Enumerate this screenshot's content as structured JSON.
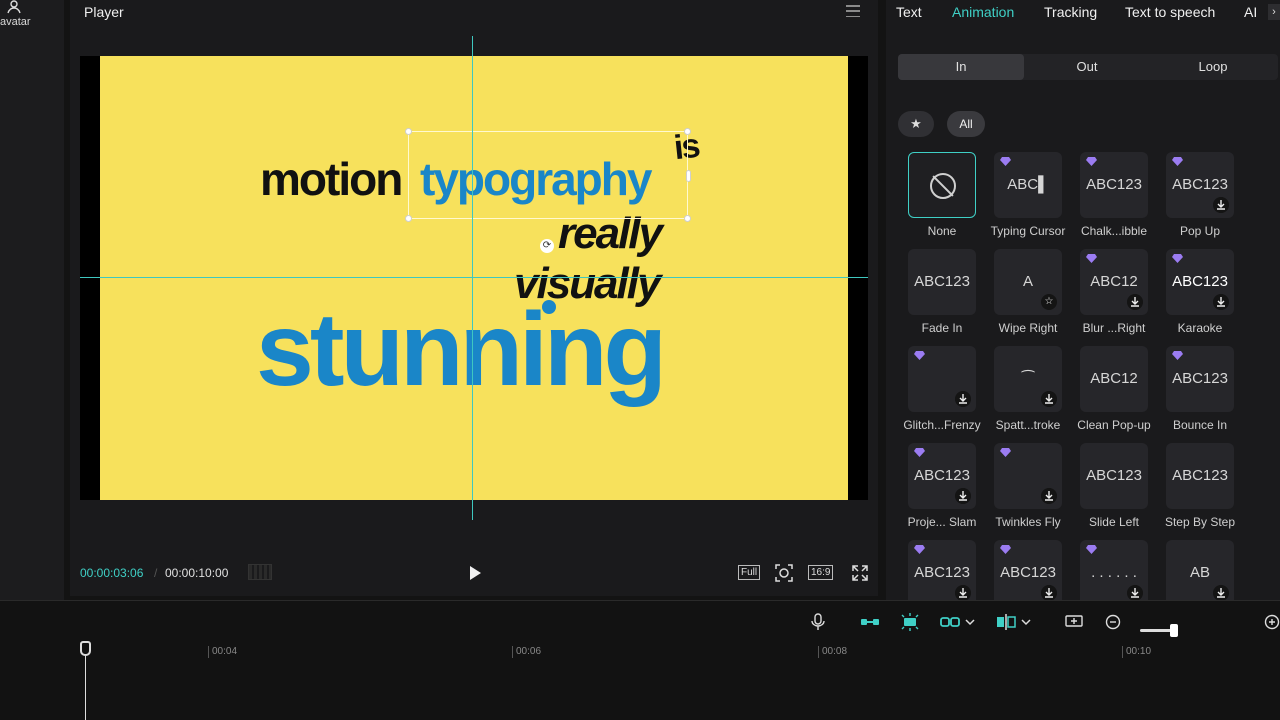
{
  "left_rail": {
    "label": "avatar"
  },
  "player": {
    "title": "Player",
    "canvas_words": {
      "motion": "motion",
      "typography": "typography",
      "is": "is",
      "really": "really",
      "visually": "visually",
      "stunning": "stunning"
    },
    "time_current": "00:00:03:06",
    "time_separator": "/",
    "time_total": "00:00:10:00",
    "full_label": "Full",
    "ratio_label": "16:9",
    "colors": {
      "canvas": "#f7e15c",
      "accent_text": "#1a86c8",
      "guide": "#3fc7c0"
    }
  },
  "right_panel": {
    "tabs": [
      "Text",
      "Animation",
      "Tracking",
      "Text to speech",
      "AI"
    ],
    "active_tab": "Animation",
    "segments": [
      "In",
      "Out",
      "Loop"
    ],
    "active_segment": "In",
    "filters": {
      "star": "★",
      "all": "All"
    },
    "effects": [
      {
        "label": "None",
        "preview": "",
        "gem": false,
        "badge": "none",
        "icon": "none-icon"
      },
      {
        "label": "Typing Cursor",
        "preview": "ABC▌",
        "gem": true,
        "badge": "none"
      },
      {
        "label": "Chalk...ibble",
        "preview": "ABC123",
        "gem": true,
        "badge": "none"
      },
      {
        "label": "Pop Up",
        "preview": "ABC123",
        "gem": true,
        "badge": "download"
      },
      {
        "label": "Fade In",
        "preview": "ABC123",
        "gem": false,
        "badge": "none"
      },
      {
        "label": "Wipe Right",
        "preview": "A",
        "gem": false,
        "badge": "favorite"
      },
      {
        "label": "Blur ...Right",
        "preview": "ABC12",
        "gem": true,
        "badge": "download"
      },
      {
        "label": "Karaoke",
        "preview": "ABC123",
        "gem": true,
        "badge": "download"
      },
      {
        "label": "Glitch...Frenzy",
        "preview": "",
        "gem": true,
        "badge": "download"
      },
      {
        "label": "Spatt...troke",
        "preview": "⁀",
        "gem": false,
        "badge": "download"
      },
      {
        "label": "Clean Pop-up",
        "preview": "ABC12",
        "gem": false,
        "badge": "none"
      },
      {
        "label": "Bounce In",
        "preview": "ABC123",
        "gem": true,
        "badge": "none"
      },
      {
        "label": "Proje... Slam",
        "preview": "ABC123",
        "gem": true,
        "badge": "download"
      },
      {
        "label": "Twinkles Fly",
        "preview": "",
        "gem": true,
        "badge": "download"
      },
      {
        "label": "Slide Left",
        "preview": "ABC123",
        "gem": false,
        "badge": "none"
      },
      {
        "label": "Step By Step",
        "preview": "ABC123",
        "gem": false,
        "badge": "none"
      },
      {
        "label": "",
        "preview": "ABC123",
        "gem": true,
        "badge": "download"
      },
      {
        "label": "",
        "preview": "ABC123",
        "gem": true,
        "badge": "download"
      },
      {
        "label": "",
        "preview": ". . . . . .",
        "gem": true,
        "badge": "download"
      },
      {
        "label": "",
        "preview": "AB",
        "gem": false,
        "badge": "download"
      }
    ]
  },
  "timeline": {
    "ticks": [
      "00:04",
      "00:06",
      "00:08",
      "00:10"
    ]
  }
}
